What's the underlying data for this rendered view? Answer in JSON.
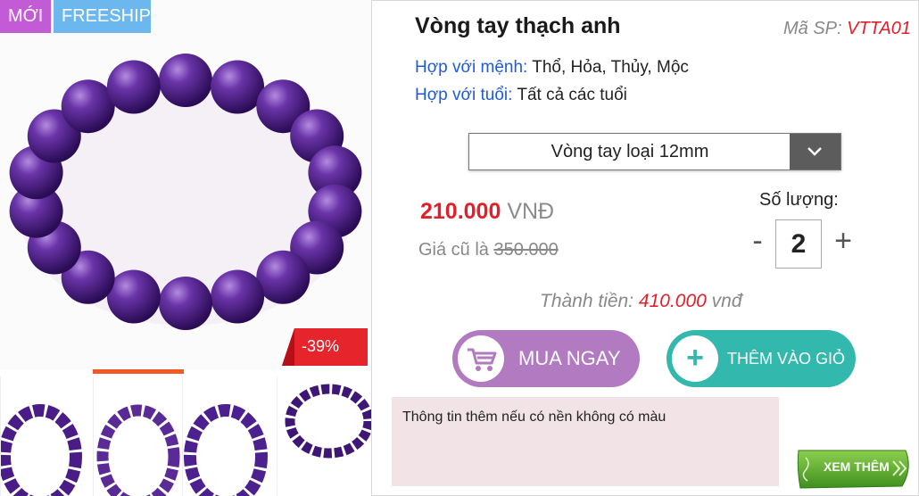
{
  "badges": {
    "new": "MỚI",
    "freeship": "FREESHIP",
    "discount": "-39%"
  },
  "product": {
    "title": "Vòng tay thạch anh",
    "sku_label": "Mã SP: ",
    "sku_value": "VTTA01",
    "attributes": [
      {
        "label": "Hợp với mệnh:",
        "value": " Thổ, Hỏa, Thủy, Mộc"
      },
      {
        "label": "Hợp với tuổi:",
        "value": " Tất cả các tuổi"
      }
    ]
  },
  "variant": {
    "selected": "Vòng tay loại 12mm",
    "toggle_icon": "chevron-down-icon"
  },
  "price": {
    "current": "210.000",
    "currency": " VNĐ",
    "old_label": "Giá cũ là ",
    "old_value": "350.000"
  },
  "quantity": {
    "label": "Số lượng:",
    "value": "2",
    "minus": "-",
    "plus": "+"
  },
  "total": {
    "label": "Thành tiền: ",
    "value": "410.000",
    "unit": " vnđ"
  },
  "actions": {
    "buy_label": "MUA NGAY",
    "buy_icon": "cart-icon",
    "cart_label": "THÊM VÀO GIỎ",
    "cart_icon": "plus-icon",
    "more_label": "XEM THÊM"
  },
  "extra_info": "Thông tin thêm nếu có nền không có màu",
  "colors": {
    "badge_new": "#c45bd6",
    "badge_freeship": "#6cb8ee",
    "discount": "#e5242c",
    "price_red": "#e0202a",
    "link_blue": "#1f5bd6",
    "buy_button": "#b27ac0",
    "cart_button": "#33b8ad",
    "thumb_active": "#f05a24",
    "more_button": "#5aa830"
  }
}
